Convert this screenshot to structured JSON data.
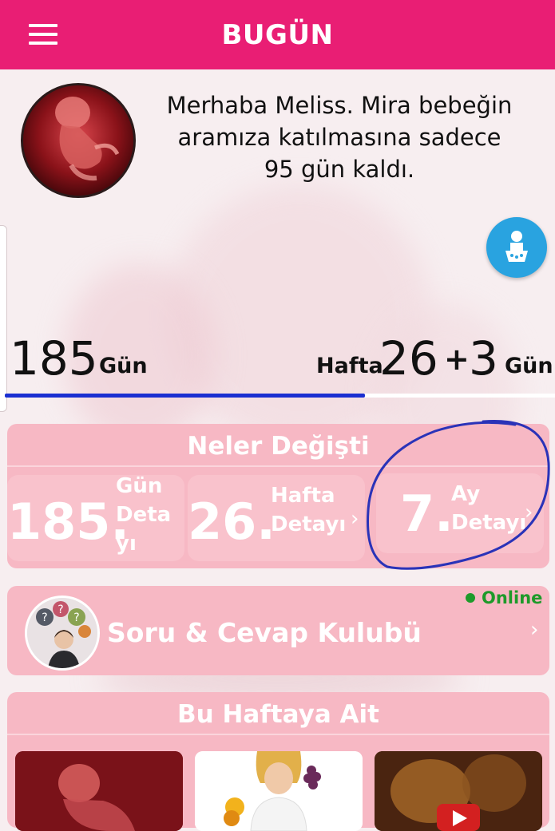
{
  "header": {
    "title": "BUGÜN"
  },
  "greeting": {
    "line1": "Merhaba Meliss. Mira bebeğin",
    "line2": "aramıza katılmasına sadece",
    "line3": "95 gün kaldı."
  },
  "progress": {
    "days_value": "185",
    "days_label": "Gün",
    "week_label": "Hafta",
    "week_value": "26",
    "plus": "+",
    "extra_days_value": "3",
    "extra_days_label": "Gün",
    "fraction": 0.655
  },
  "changes": {
    "title": "Neler Değişti",
    "day": {
      "number": "185.",
      "label_l1": "Gün",
      "label_l2": "Deta",
      "label_l3": "yı"
    },
    "week": {
      "number": "26.",
      "label_l1": "Hafta",
      "label_l2": "Detayı"
    },
    "month": {
      "number": "7.",
      "label_l1": "Ay",
      "label_l2": "Detayı"
    }
  },
  "qa": {
    "title": "Soru & Cevap Kulubü",
    "status": "Online"
  },
  "this_week": {
    "title": "Bu Haftaya Ait"
  },
  "colors": {
    "primary": "#e91e74",
    "card": "#f7b8c4",
    "progress": "#1a2fd1",
    "fab": "#29a3e0",
    "online": "#1e9a2a",
    "annotation": "#2a33b8"
  },
  "icons": [
    "menu-icon",
    "baby-icon",
    "chevron-right-icon"
  ]
}
